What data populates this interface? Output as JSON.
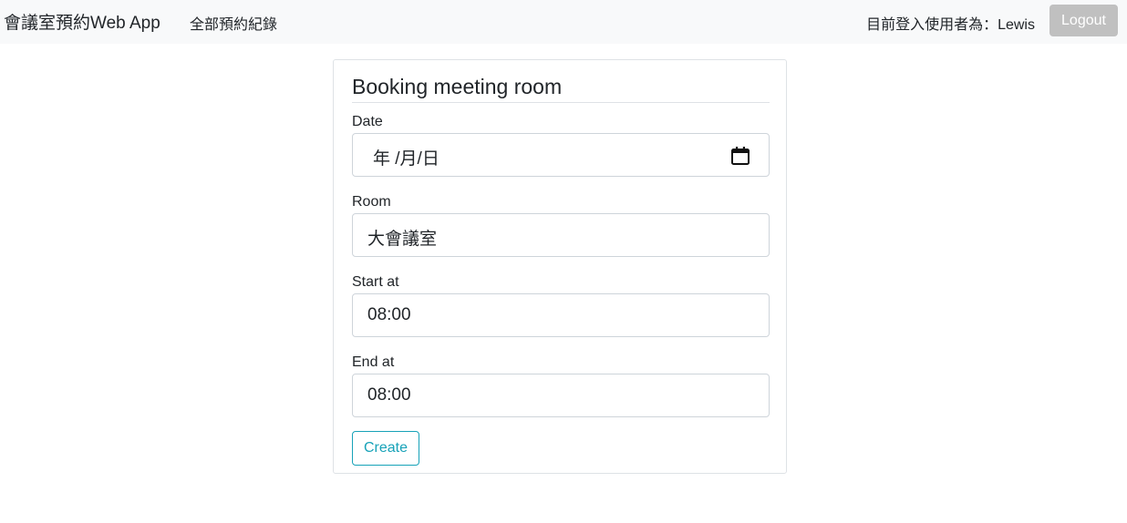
{
  "navbar": {
    "brand": "會議室預約Web App",
    "all_bookings_link": "全部預約紀錄",
    "logged_in_text": "目前登入使用者為：Lewis",
    "logout_label": "Logout"
  },
  "form": {
    "title": "Booking meeting room",
    "date": {
      "label": "Date",
      "value": "年 /月/日",
      "icon": "calendar-icon"
    },
    "room": {
      "label": "Room",
      "value": "大會議室"
    },
    "start_at": {
      "label": "Start at",
      "value": "08:00"
    },
    "end_at": {
      "label": "End at",
      "value": "08:00"
    },
    "create_label": "Create"
  },
  "colors": {
    "navbar_bg": "#f8f9fa",
    "logout_bg": "#c0c0c0",
    "create_accent": "#17a2b8",
    "border": "#ced4da"
  }
}
